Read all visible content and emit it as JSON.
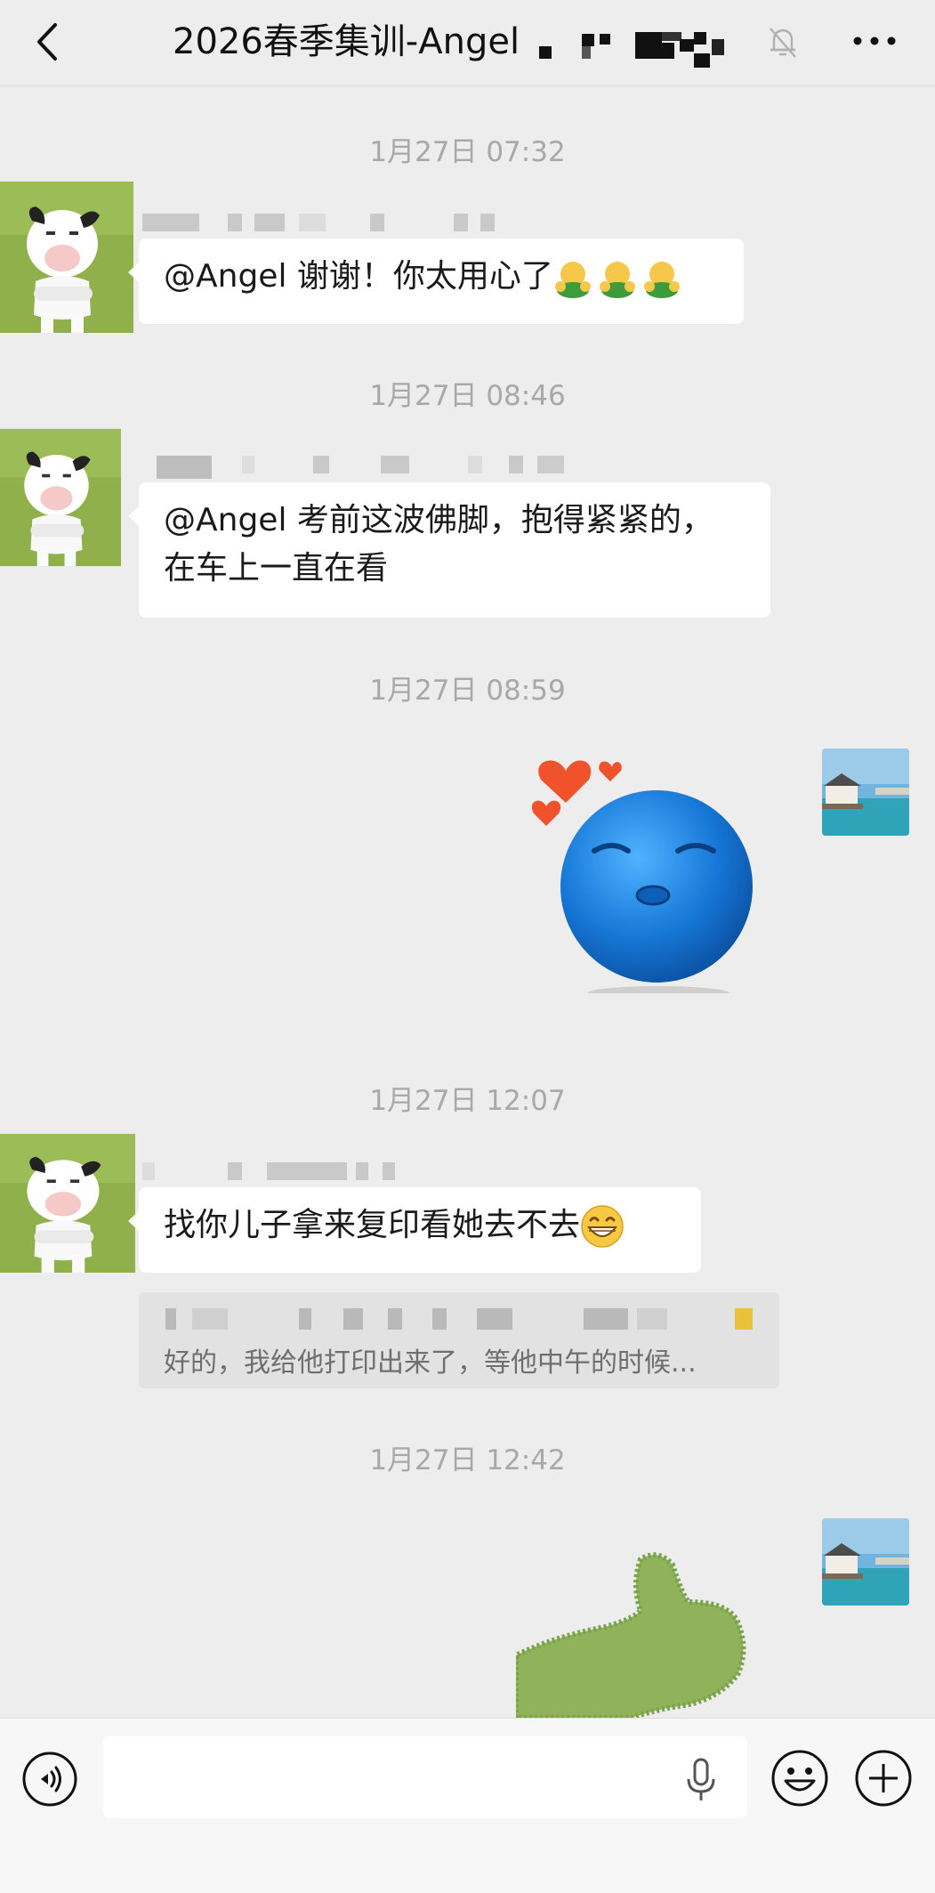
{
  "header": {
    "title": "2026春季集训-Angel",
    "back_icon": "chevron-left-icon",
    "mute_icon": "bell-muted-icon",
    "more_icon": "more-dots-icon"
  },
  "messages": [
    {
      "time": "1月27日 07:32",
      "side": "left",
      "text": "@Angel 谢谢！你太用心了",
      "emoji": "hug-emoji x3"
    },
    {
      "time": "1月27日 08:46",
      "side": "left",
      "line1": "@Angel 考前这波佛脚，抱得紧紧的，",
      "line2": "在车上一直在看"
    },
    {
      "time": "1月27日 08:59",
      "side": "right",
      "sticker": "blue-kiss-face-with-hearts-sticker"
    },
    {
      "time": "1月27日 12:07",
      "side": "left",
      "text": "找你儿子拿来复印看她去不去",
      "emoji": "grin-emoji",
      "quote": "好的，我给他打印出来了，等他中午的时候..."
    },
    {
      "time": "1月27日 12:42",
      "side": "right",
      "sticker": "green-thumbs-up-sticker"
    }
  ],
  "input": {
    "placeholder": "",
    "voice_icon": "voice-icon",
    "mic_icon": "mic-icon",
    "emoji_icon": "emoji-icon",
    "plus_icon": "plus-icon"
  },
  "colors": {
    "background": "#ededed",
    "bubble": "#ffffff",
    "timestamp": "#a8a8a8"
  }
}
